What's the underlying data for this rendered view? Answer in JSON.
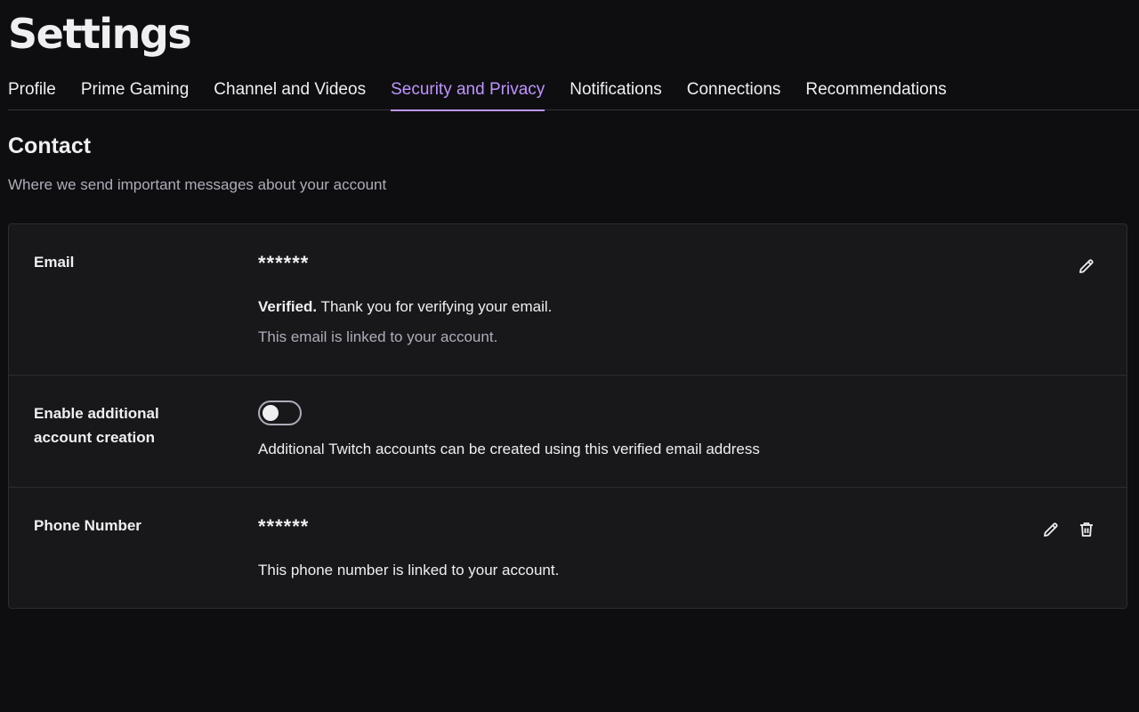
{
  "page": {
    "title": "Settings"
  },
  "tabs": [
    {
      "label": "Profile",
      "active": false
    },
    {
      "label": "Prime Gaming",
      "active": false
    },
    {
      "label": "Channel and Videos",
      "active": false
    },
    {
      "label": "Security and Privacy",
      "active": true
    },
    {
      "label": "Notifications",
      "active": false
    },
    {
      "label": "Connections",
      "active": false
    },
    {
      "label": "Recommendations",
      "active": false
    }
  ],
  "contact": {
    "title": "Contact",
    "subtitle": "Where we send important messages about your account",
    "email": {
      "label": "Email",
      "value": "******",
      "verified_prefix": "Verified.",
      "verified_text": " Thank you for verifying your email.",
      "linked_text": "This email is linked to your account.",
      "edit_icon": "pencil-icon"
    },
    "additional_accounts": {
      "label_line1": "Enable additional",
      "label_line2": "account creation",
      "enabled": false,
      "description": "Additional Twitch accounts can be created using this verified email address"
    },
    "phone": {
      "label": "Phone Number",
      "value": "******",
      "linked_text": "This phone number is linked to your account.",
      "edit_icon": "pencil-icon",
      "delete_icon": "trash-icon"
    }
  },
  "colors": {
    "background": "#0e0e10",
    "panel": "#18181b",
    "accent": "#bf94ff",
    "text": "#efeff1",
    "muted": "#adadb8"
  }
}
